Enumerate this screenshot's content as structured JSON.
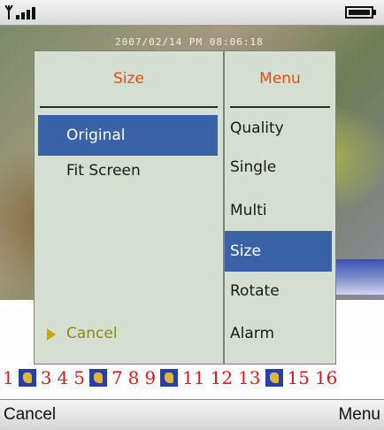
{
  "camera": {
    "timestamp": "2007/02/14 PM 08:06:18"
  },
  "size_menu": {
    "title": "Size",
    "items": [
      {
        "label": "Original",
        "selected": true
      },
      {
        "label": "Fit Screen",
        "selected": false
      }
    ],
    "cancel_label": "Cancel"
  },
  "main_menu": {
    "title": "Menu",
    "items": [
      {
        "label": "Quality",
        "selected": false
      },
      {
        "label": "Single",
        "selected": false
      },
      {
        "label": "Multi",
        "selected": false
      },
      {
        "label": "Size",
        "selected": true
      },
      {
        "label": "Rotate",
        "selected": false
      },
      {
        "label": "Alarm",
        "selected": false
      }
    ]
  },
  "thumbnail_strip": {
    "numbers": [
      "1",
      "3",
      "4",
      "5",
      "7",
      "8",
      "9",
      "11",
      "12",
      "13",
      "15",
      "16"
    ]
  },
  "softkeys": {
    "left": "Cancel",
    "right": "Menu"
  },
  "colors": {
    "menu_bg": "#d5dfd1",
    "highlight": "#3a62a8",
    "title_text": "#e84a18",
    "cancel_text": "#8a8a10",
    "number_text": "#e01818"
  }
}
